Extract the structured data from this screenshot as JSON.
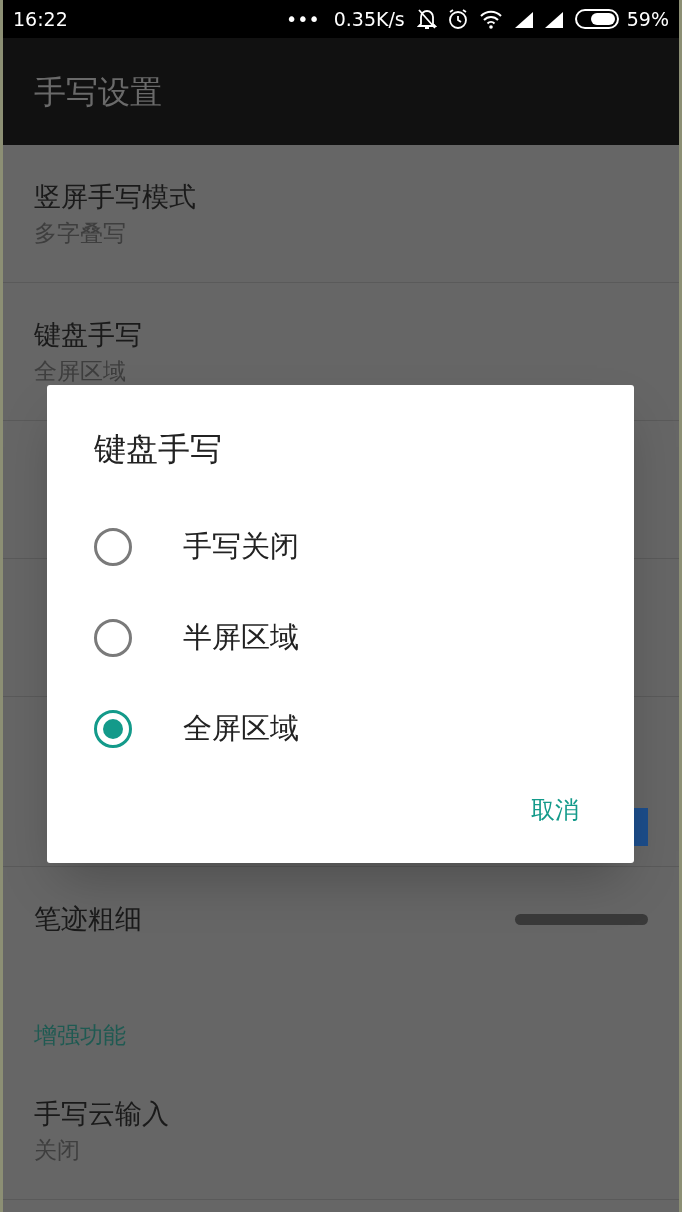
{
  "status_bar": {
    "time": "16:22",
    "more": "•••",
    "speed": "0.35K/s",
    "battery": "59%"
  },
  "app_bar": {
    "title": "手写设置"
  },
  "settings": [
    {
      "kind": "item",
      "title": "竖屏手写模式",
      "summary": "多字叠写"
    },
    {
      "kind": "item",
      "title": "键盘手写",
      "summary": "全屏区域"
    },
    {
      "kind": "item"
    },
    {
      "kind": "item"
    },
    {
      "kind": "header"
    },
    {
      "kind": "color",
      "color": "#1d4e8c"
    },
    {
      "kind": "thickness",
      "title": "笔迹粗细"
    },
    {
      "kind": "header",
      "title": "增强功能"
    },
    {
      "kind": "item",
      "title": "手写云输入",
      "summary": "关闭"
    }
  ],
  "dialog": {
    "title": "键盘手写",
    "options": [
      {
        "label": "手写关闭",
        "selected": false
      },
      {
        "label": "半屏区域",
        "selected": false
      },
      {
        "label": "全屏区域",
        "selected": true
      }
    ],
    "cancel": "取消"
  }
}
